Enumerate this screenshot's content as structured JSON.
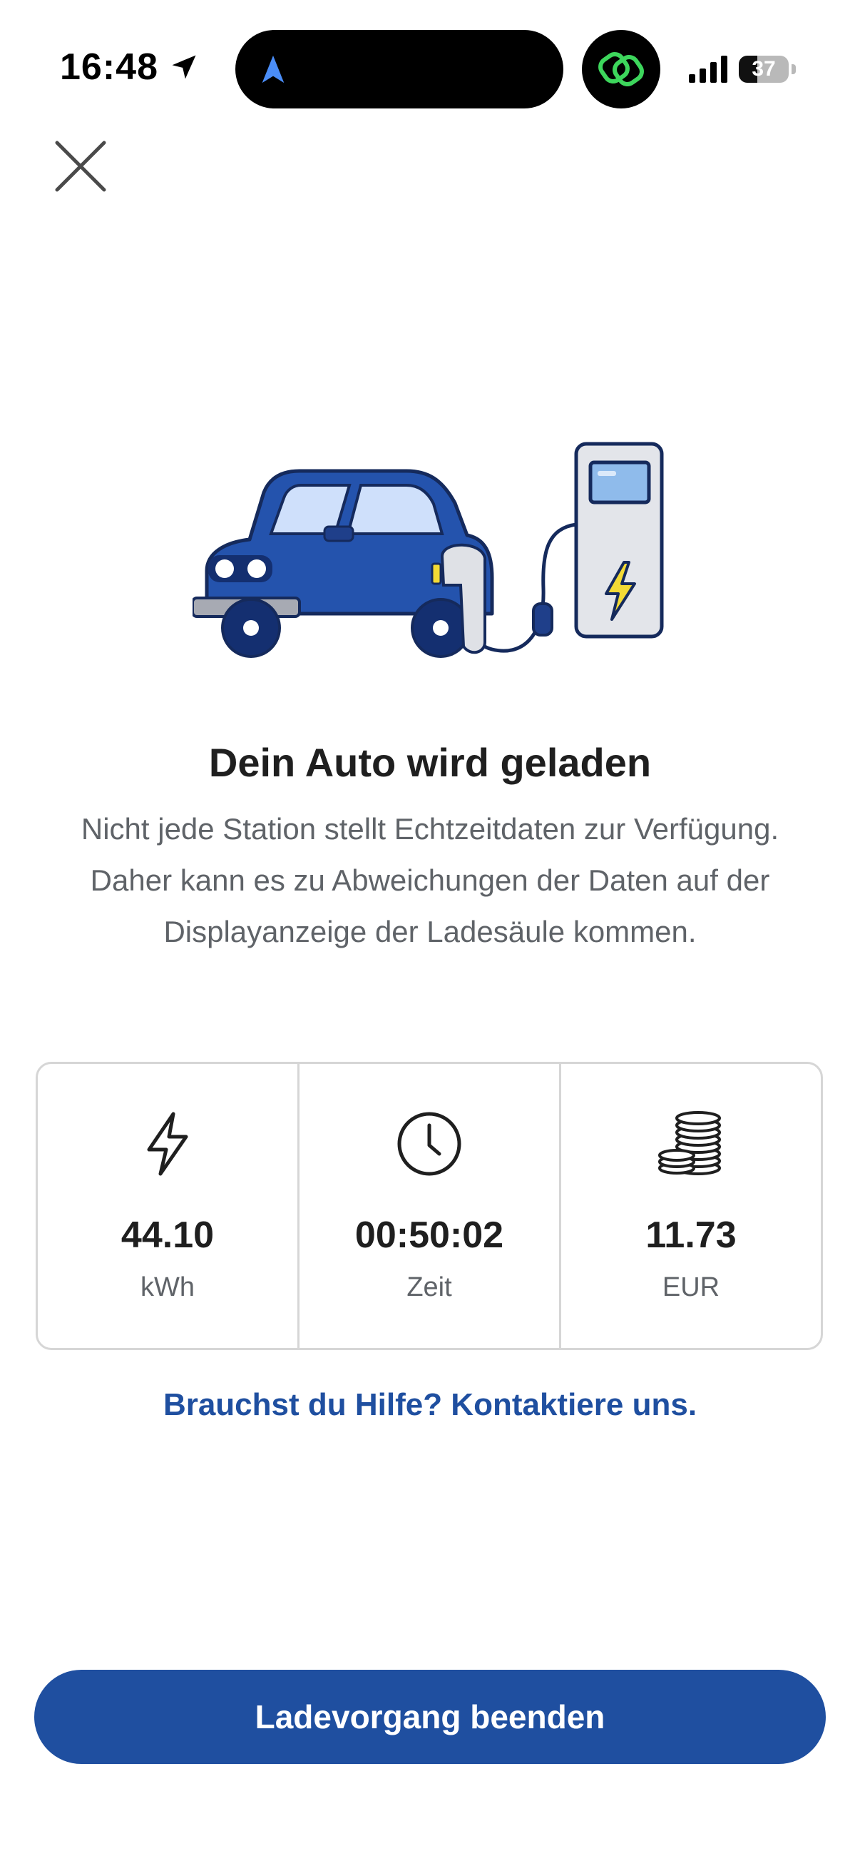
{
  "status_bar": {
    "time": "16:48",
    "battery": "37",
    "battery_fraction": 0.37
  },
  "header": {
    "close_icon": "close-icon"
  },
  "illustration": {
    "icon": "car-charging-illustration"
  },
  "content": {
    "title": "Dein Auto wird geladen",
    "description": "Nicht jede Station stellt Echtzeitdaten zur Verfügung. Daher kann es zu Abweichungen der Daten auf der Displayanzeige der Ladesäule kommen."
  },
  "stats": {
    "energy": {
      "icon": "lightning-icon",
      "value": "44.10",
      "unit": "kWh"
    },
    "time": {
      "icon": "clock-icon",
      "value": "00:50:02",
      "unit": "Zeit"
    },
    "cost": {
      "icon": "coins-icon",
      "value": "11.73",
      "unit": "EUR"
    }
  },
  "help_link": "Brauchst du Hilfe? Kontaktiere uns.",
  "primary_action": "Ladevorgang beenden",
  "colors": {
    "brand_blue": "#1f4fa0",
    "text_dark": "#1f1f1f",
    "text_muted": "#5f6368",
    "border": "#d6d6d6"
  }
}
